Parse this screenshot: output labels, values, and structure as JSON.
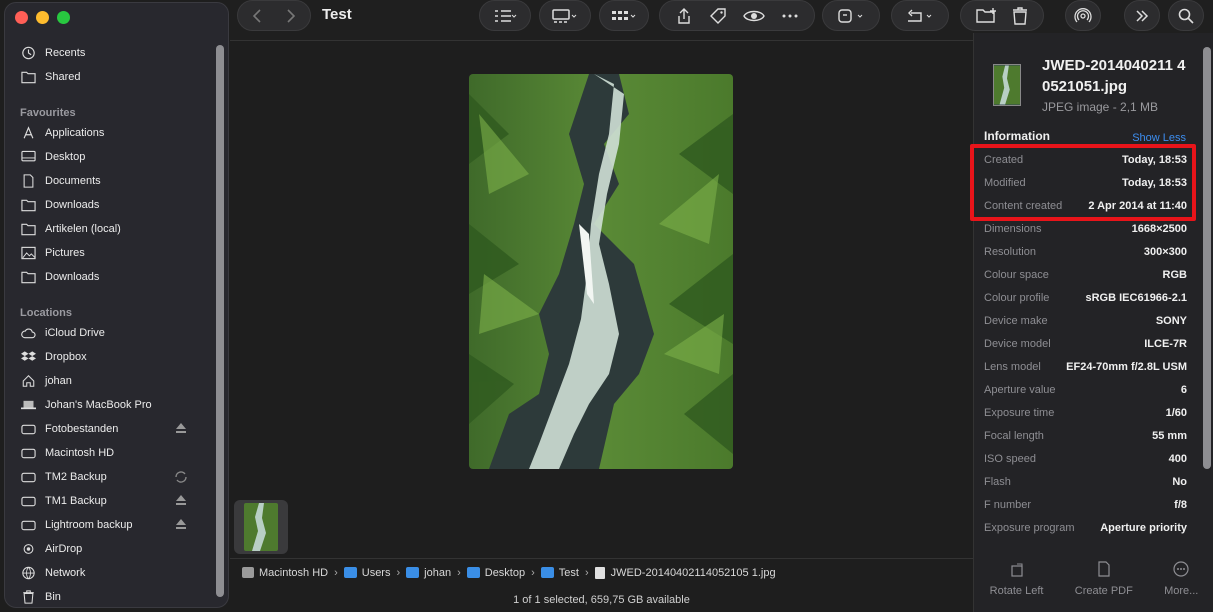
{
  "window": {
    "title": "Test"
  },
  "sidebar": {
    "recents_label": "Recents",
    "shared_label": "Shared",
    "favourites_title": "Favourites",
    "favourites": [
      "Applications",
      "Desktop",
      "Documents",
      "Downloads",
      "Artikelen (local)",
      "Pictures",
      "Downloads"
    ],
    "locations_title": "Locations",
    "locations": [
      "iCloud Drive",
      "Dropbox",
      "johan",
      "Johan's MacBook Pro",
      "Fotobestanden",
      "Macintosh HD",
      "TM2 Backup",
      "TM1 Backup",
      "Lightroom backup",
      "AirDrop",
      "Network",
      "Bin"
    ]
  },
  "path": [
    "Macintosh HD",
    "Users",
    "johan",
    "Desktop",
    "Test",
    "JWED-20140402114052105 1.jpg"
  ],
  "path_items": [
    {
      "label": "Macintosh HD"
    },
    {
      "label": "Users"
    },
    {
      "label": "johan"
    },
    {
      "label": "Desktop"
    },
    {
      "label": "Test"
    },
    {
      "label": "JWED-20140402114052105 1.jpg"
    }
  ],
  "status": "1 of 1 selected, 659,75 GB available",
  "inspector": {
    "file_name": "JWED-2014040211 40521051.jpg",
    "file_kind": "JPEG image - 2,1 MB",
    "info_title": "Information",
    "show_less": "Show Less",
    "rows": [
      {
        "k": "Created",
        "v": "Today, 18:53"
      },
      {
        "k": "Modified",
        "v": "Today, 18:53"
      },
      {
        "k": "Content created",
        "v": "2 Apr 2014 at 11:40"
      },
      {
        "k": "Dimensions",
        "v": "1668×2500"
      },
      {
        "k": "Resolution",
        "v": "300×300"
      },
      {
        "k": "Colour space",
        "v": "RGB"
      },
      {
        "k": "Colour profile",
        "v": "sRGB IEC61966-2.1"
      },
      {
        "k": "Device make",
        "v": "SONY"
      },
      {
        "k": "Device model",
        "v": "ILCE-7R"
      },
      {
        "k": "Lens model",
        "v": "EF24-70mm f/2.8L USM"
      },
      {
        "k": "Aperture value",
        "v": "6"
      },
      {
        "k": "Exposure time",
        "v": "1/60"
      },
      {
        "k": "Focal length",
        "v": "55 mm"
      },
      {
        "k": "ISO speed",
        "v": "400"
      },
      {
        "k": "Flash",
        "v": "No"
      },
      {
        "k": "F number",
        "v": "f/8"
      },
      {
        "k": "Exposure program",
        "v": "Aperture priority"
      }
    ],
    "actions": [
      "Rotate Left",
      "Create PDF",
      "More..."
    ]
  },
  "colors": {
    "highlight": "#e8141a",
    "accent": "#3d8ef0"
  }
}
